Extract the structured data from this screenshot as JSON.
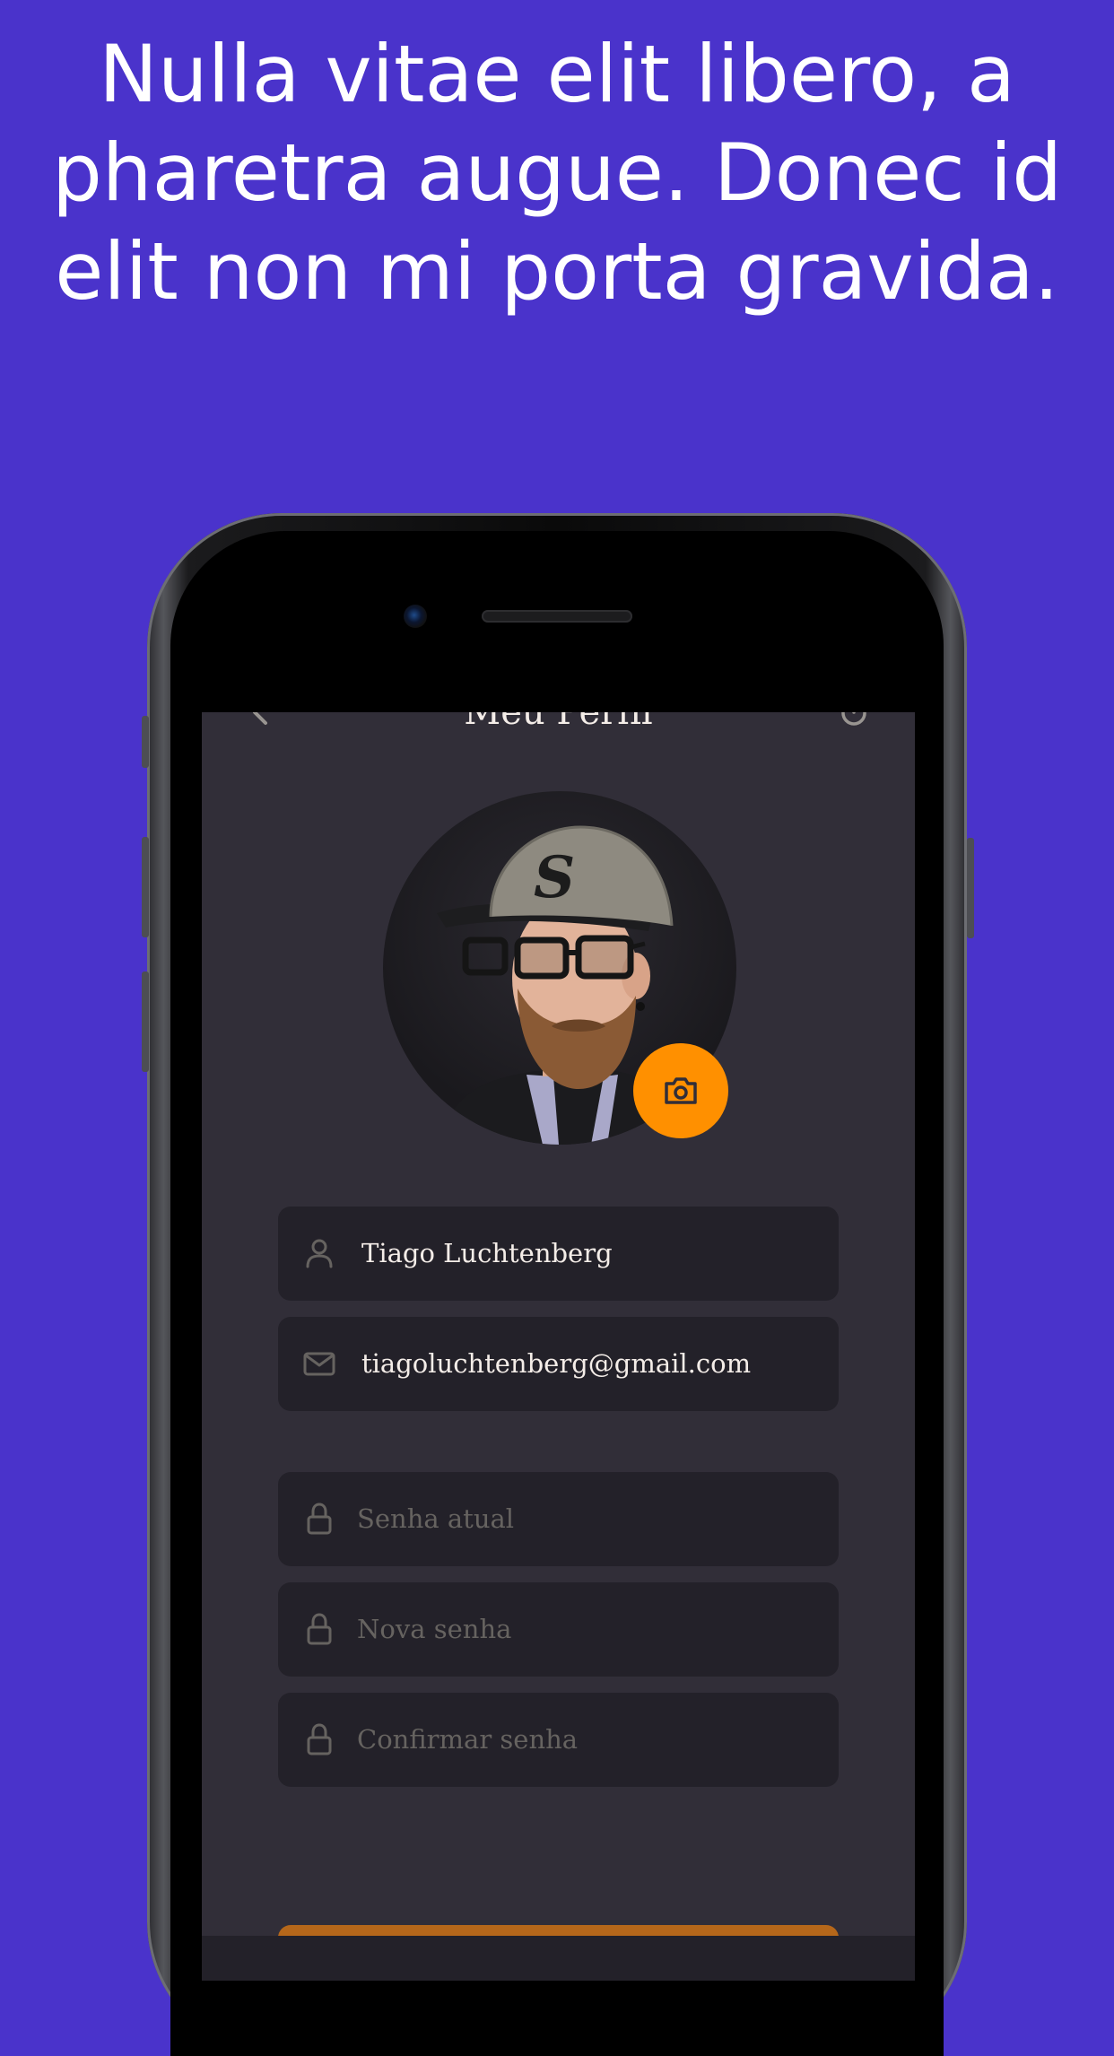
{
  "headline": {
    "line1": "Nulla vitae elit libero, a",
    "line2": "pharetra augue. Donec id",
    "line3": "elit non mi porta gravida."
  },
  "screen": {
    "title": "Meu Perfil",
    "profile": {
      "name": "Tiago Luchtenberg",
      "email": "tiagoluchtenberg@gmail.com"
    },
    "password_fields": {
      "current_placeholder": "Senha atual",
      "new_placeholder": "Nova senha",
      "confirm_placeholder": "Confirmar senha"
    }
  },
  "icons": {
    "back": "chevron-left-icon",
    "logout": "power-icon",
    "camera": "camera-icon",
    "name": "user-icon",
    "email": "mail-icon",
    "password": "lock-icon"
  },
  "colors": {
    "background": "#4a33cb",
    "screen_bg": "#312e38",
    "field_bg": "#232129",
    "accent": "#ff9000",
    "text": "#f4ede8",
    "placeholder": "#666360"
  }
}
